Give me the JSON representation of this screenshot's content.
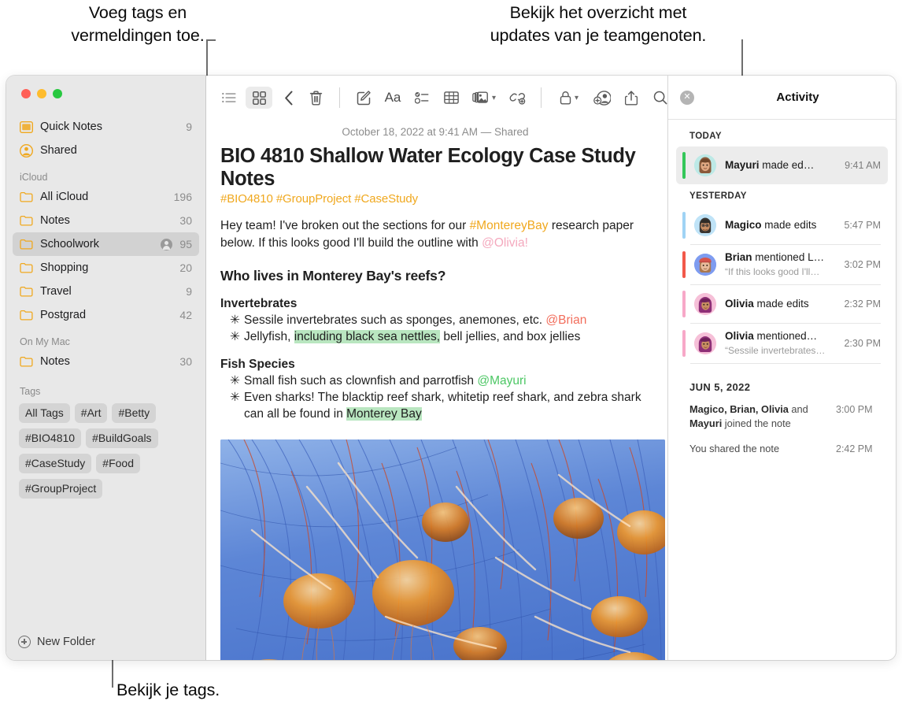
{
  "annotations": {
    "top_left": "Voeg tags en\nvermeldingen toe.",
    "top_right": "Bekijk het overzicht met\nupdates van je teamgenoten.",
    "bottom": "Bekijk je tags."
  },
  "sidebar": {
    "top_items": [
      {
        "label": "Quick Notes",
        "count": "9",
        "icon": "quick-notes-icon"
      },
      {
        "label": "Shared",
        "count": "",
        "icon": "shared-person-icon"
      }
    ],
    "sections": [
      {
        "header": "iCloud",
        "items": [
          {
            "label": "All iCloud",
            "count": "196",
            "shared": false,
            "selected": false
          },
          {
            "label": "Notes",
            "count": "30",
            "shared": false,
            "selected": false
          },
          {
            "label": "Schoolwork",
            "count": "95",
            "shared": true,
            "selected": true
          },
          {
            "label": "Shopping",
            "count": "20",
            "shared": false,
            "selected": false
          },
          {
            "label": "Travel",
            "count": "9",
            "shared": false,
            "selected": false
          },
          {
            "label": "Postgrad",
            "count": "42",
            "shared": false,
            "selected": false
          }
        ]
      },
      {
        "header": "On My Mac",
        "items": [
          {
            "label": "Notes",
            "count": "30",
            "shared": false,
            "selected": false
          }
        ]
      }
    ],
    "tags_header": "Tags",
    "tags": [
      "All Tags",
      "#Art",
      "#Betty",
      "#BIO4810",
      "#BuildGoals",
      "#CaseStudy",
      "#Food",
      "#GroupProject"
    ],
    "new_folder_label": "New Folder"
  },
  "toolbar": {
    "left": [
      {
        "name": "list-view-icon",
        "active": false
      },
      {
        "name": "gallery-view-icon",
        "active": true
      },
      {
        "name": "back-chevron-icon",
        "active": false
      }
    ],
    "right": [
      {
        "name": "trash-icon"
      },
      {
        "name": "compose-icon"
      },
      {
        "name": "format-aa-icon"
      },
      {
        "name": "checklist-icon"
      },
      {
        "name": "table-icon"
      },
      {
        "name": "media-icon"
      },
      {
        "name": "link-icon"
      },
      {
        "name": "lock-icon"
      },
      {
        "name": "add-people-icon"
      },
      {
        "name": "share-icon"
      },
      {
        "name": "search-icon"
      }
    ]
  },
  "note": {
    "date": "October 18, 2022 at 9:41 AM — Shared",
    "title": "BIO 4810 Shallow Water Ecology Case Study Notes",
    "tags_line": "#BIO4810 #GroupProject #CaseStudy",
    "intro": {
      "part1": "Hey team! I've broken out the sections for our ",
      "tag": "#MontereyBay",
      "part2": " research paper below. If this looks good I'll build the outline with ",
      "mention": "@Olivia!"
    },
    "heading": "Who lives in Monterey Bay's reefs?",
    "sections": [
      {
        "subheading": "Invertebrates",
        "items": [
          {
            "text_before": "Sessile invertebrates such as sponges, anemones, etc. ",
            "mention": "@Brian",
            "mention_color": "red",
            "highlight": "",
            "text_mid": "",
            "text_after": ""
          },
          {
            "text_before": "Jellyfish, ",
            "mention": "",
            "mention_color": "",
            "highlight": "including black sea nettles,",
            "text_mid": "",
            "text_after": " bell jellies, and box jellies"
          }
        ]
      },
      {
        "subheading": "Fish Species",
        "items": [
          {
            "text_before": "Small fish such as clownfish and parrotfish ",
            "mention": "@Mayuri",
            "mention_color": "green",
            "highlight": "",
            "text_mid": "",
            "text_after": ""
          },
          {
            "text_before": "Even sharks! The blacktip reef shark, whitetip reef shark, and zebra shark can all be found in ",
            "mention": "",
            "mention_color": "",
            "highlight": "Monterey Bay",
            "text_mid": "",
            "text_after": ""
          }
        ]
      }
    ],
    "image_alt": "jellyfish-photo"
  },
  "activity": {
    "title": "Activity",
    "close_icon": "close-icon",
    "groups": [
      {
        "header": "TODAY",
        "style": "small",
        "items": [
          {
            "name": "Mayuri",
            "action": "made ed…",
            "quote": "",
            "time": "9:41 AM",
            "bar_color": "#34c759",
            "avatar_bg": "#bde9e6",
            "avatar_hair": "#8a5a3b",
            "avatar_skin": "#e0a882",
            "selected": true,
            "divider": false
          }
        ]
      },
      {
        "header": "YESTERDAY",
        "style": "small",
        "items": [
          {
            "name": "Magico",
            "action": "made edits",
            "quote": "",
            "time": "5:47 PM",
            "bar_color": "#9fd3f5",
            "avatar_bg": "#bfe3f7",
            "avatar_hair": "#3a3632",
            "avatar_skin": "#c98e63",
            "selected": false,
            "divider": true
          },
          {
            "name": "Brian",
            "action": "mentioned L…",
            "quote": "“If this looks good I'll…",
            "time": "3:02 PM",
            "bar_color": "#f2584a",
            "avatar_bg": "#7e9cf0",
            "avatar_hair": "#d8544a",
            "avatar_skin": "#e8bb9b",
            "selected": false,
            "divider": true
          },
          {
            "name": "Olivia",
            "action": "made edits",
            "quote": "",
            "time": "2:32 PM",
            "bar_color": "#f7a8c8",
            "avatar_bg": "#f6c0d8",
            "avatar_hair": "#8e2f77",
            "avatar_skin": "#c98e63",
            "selected": false,
            "divider": true
          },
          {
            "name": "Olivia",
            "action": "mentioned…",
            "quote": "“Sessile invertebrates…",
            "time": "2:30 PM",
            "bar_color": "#f7a8c8",
            "avatar_bg": "#f6c0d8",
            "avatar_hair": "#8e2f77",
            "avatar_skin": "#c98e63",
            "selected": false,
            "divider": true
          }
        ]
      }
    ],
    "older": {
      "header": "JUN 5, 2022",
      "entries": [
        {
          "bold": "Magico, Brian, Olivia",
          "rest": " and ",
          "bold2": "Mayuri",
          "rest2": " joined the note",
          "time": "3:00 PM"
        },
        {
          "bold": "",
          "rest": "You shared the note",
          "bold2": "",
          "rest2": "",
          "time": "2:42 PM"
        }
      ]
    }
  }
}
